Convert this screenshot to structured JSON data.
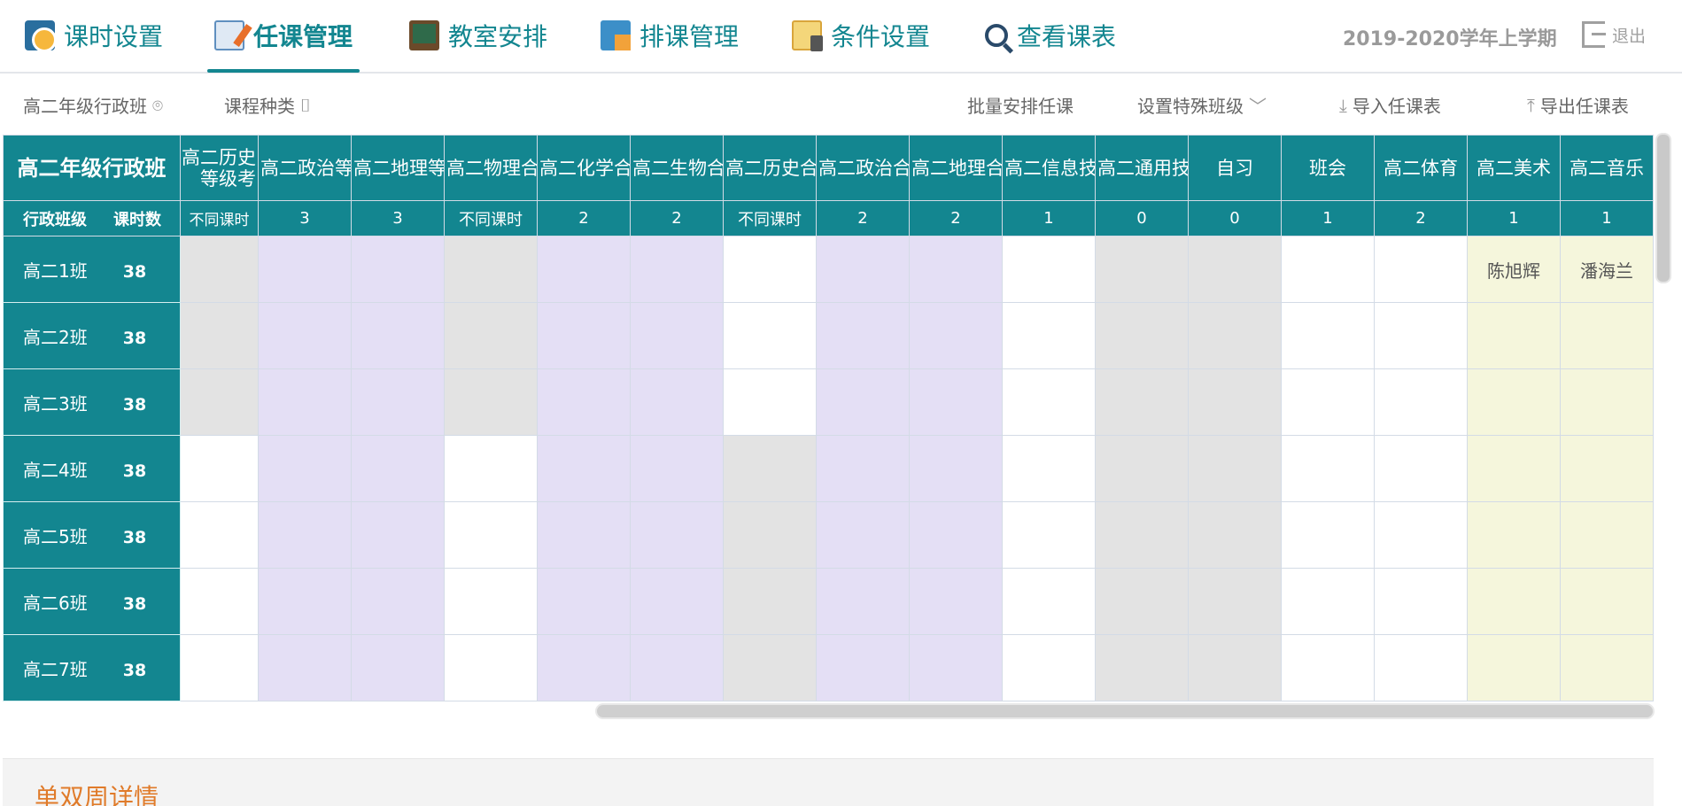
{
  "nav": {
    "items": [
      {
        "label": "课时设置",
        "icon": "clock-settings-icon"
      },
      {
        "label": "任课管理",
        "icon": "task-edit-icon",
        "active": true
      },
      {
        "label": "教室安排",
        "icon": "blackboard-icon"
      },
      {
        "label": "排课管理",
        "icon": "schedule-grid-icon"
      },
      {
        "label": "条件设置",
        "icon": "conditions-icon"
      },
      {
        "label": "查看课表",
        "icon": "search-icon"
      }
    ],
    "term": "2019-2020学年上学期",
    "logout": "退出",
    "accent_color": "#138690"
  },
  "toolbar": {
    "class_filter": "高二年级行政班",
    "course_type": "课程种类",
    "batch_assign": "批量安排任课",
    "special_class": "设置特殊班级",
    "import": "导入任课表",
    "export": "导出任课表"
  },
  "grid": {
    "corner_title": "高二年级行政班",
    "corner_col1": "行政班级",
    "corner_col2": "课时数",
    "subjects": [
      {
        "name": "高二历史等级考",
        "hours": "不同课时"
      },
      {
        "name": "高二政治等级考",
        "hours": "3"
      },
      {
        "name": "高二地理等级考",
        "hours": "3"
      },
      {
        "name": "高二物理合格考",
        "hours": "不同课时"
      },
      {
        "name": "高二化学合格考",
        "hours": "2"
      },
      {
        "name": "高二生物合格考",
        "hours": "2"
      },
      {
        "name": "高二历史合格考",
        "hours": "不同课时"
      },
      {
        "name": "高二政治合格考",
        "hours": "2"
      },
      {
        "name": "高二地理合格考",
        "hours": "2"
      },
      {
        "name": "高二信息技术",
        "hours": "1"
      },
      {
        "name": "高二通用技术",
        "hours": "0"
      },
      {
        "name": "自习",
        "hours": "0"
      },
      {
        "name": "班会",
        "hours": "1"
      },
      {
        "name": "高二体育",
        "hours": "2"
      },
      {
        "name": "高二美术",
        "hours": "1"
      },
      {
        "name": "高二音乐",
        "hours": "1"
      }
    ],
    "rows": [
      {
        "name": "高二1班",
        "hours": "38",
        "cells": [
          "gray",
          "purple",
          "purple",
          "gray",
          "purple",
          "purple",
          "white",
          "purple",
          "purple",
          "white",
          "gray",
          "gray",
          "white",
          "white",
          "yellow",
          "yellow"
        ],
        "teachers": [
          "",
          "",
          "",
          "",
          "",
          "",
          "",
          "",
          "",
          "",
          "",
          "",
          "",
          "",
          "陈旭辉",
          "潘海兰"
        ]
      },
      {
        "name": "高二2班",
        "hours": "38",
        "cells": [
          "gray",
          "purple",
          "purple",
          "gray",
          "purple",
          "purple",
          "white",
          "purple",
          "purple",
          "white",
          "gray",
          "gray",
          "white",
          "white",
          "yellow",
          "yellow"
        ],
        "teachers": [
          "",
          "",
          "",
          "",
          "",
          "",
          "",
          "",
          "",
          "",
          "",
          "",
          "",
          "",
          "",
          ""
        ]
      },
      {
        "name": "高二3班",
        "hours": "38",
        "cells": [
          "gray",
          "purple",
          "purple",
          "gray",
          "purple",
          "purple",
          "white",
          "purple",
          "purple",
          "white",
          "gray",
          "gray",
          "white",
          "white",
          "yellow",
          "yellow"
        ],
        "teachers": [
          "",
          "",
          "",
          "",
          "",
          "",
          "",
          "",
          "",
          "",
          "",
          "",
          "",
          "",
          "",
          ""
        ]
      },
      {
        "name": "高二4班",
        "hours": "38",
        "cells": [
          "white",
          "purple",
          "purple",
          "white",
          "purple",
          "purple",
          "gray",
          "purple",
          "purple",
          "white",
          "gray",
          "gray",
          "white",
          "white",
          "yellow",
          "yellow"
        ],
        "teachers": [
          "",
          "",
          "",
          "",
          "",
          "",
          "",
          "",
          "",
          "",
          "",
          "",
          "",
          "",
          "",
          ""
        ]
      },
      {
        "name": "高二5班",
        "hours": "38",
        "cells": [
          "white",
          "purple",
          "purple",
          "white",
          "purple",
          "purple",
          "gray",
          "purple",
          "purple",
          "white",
          "gray",
          "gray",
          "white",
          "white",
          "yellow",
          "yellow"
        ],
        "teachers": [
          "",
          "",
          "",
          "",
          "",
          "",
          "",
          "",
          "",
          "",
          "",
          "",
          "",
          "",
          "",
          ""
        ]
      },
      {
        "name": "高二6班",
        "hours": "38",
        "cells": [
          "white",
          "purple",
          "purple",
          "white",
          "purple",
          "purple",
          "gray",
          "purple",
          "purple",
          "white",
          "gray",
          "gray",
          "white",
          "white",
          "yellow",
          "yellow"
        ],
        "teachers": [
          "",
          "",
          "",
          "",
          "",
          "",
          "",
          "",
          "",
          "",
          "",
          "",
          "",
          "",
          "",
          ""
        ]
      },
      {
        "name": "高二7班",
        "hours": "38",
        "cells": [
          "white",
          "purple",
          "purple",
          "white",
          "purple",
          "purple",
          "gray",
          "purple",
          "purple",
          "white",
          "gray",
          "gray",
          "white",
          "white",
          "yellow",
          "yellow"
        ],
        "teachers": [
          "",
          "",
          "",
          "",
          "",
          "",
          "",
          "",
          "",
          "",
          "",
          "",
          "",
          "",
          "",
          ""
        ]
      }
    ]
  },
  "bottom": {
    "title": "单双周详情"
  }
}
